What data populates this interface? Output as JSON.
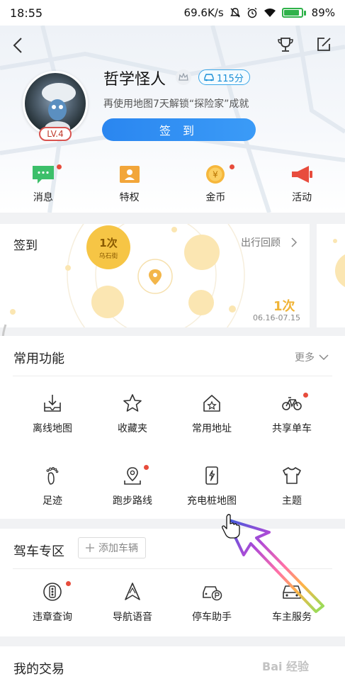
{
  "status_bar": {
    "time": "18:55",
    "network_speed": "69.6K/s",
    "battery": "89%",
    "battery_level": 0.89,
    "battery_color": "#2fb24a"
  },
  "profile": {
    "username": "哲学怪人",
    "level": "LV.4",
    "score": "115分",
    "hint": "再使用地图7天解锁“探险家”成就",
    "signin_label": "签 到"
  },
  "quick_actions": [
    {
      "label": "消息",
      "icon": "message-icon",
      "dot": true
    },
    {
      "label": "特权",
      "icon": "privilege-icon",
      "dot": false
    },
    {
      "label": "金币",
      "icon": "coin-icon",
      "dot": true
    },
    {
      "label": "活动",
      "icon": "megaphone-icon",
      "dot": false
    }
  ],
  "checkin": {
    "title": "签到",
    "trip_review": "出行回顾",
    "count": "1次",
    "place": "乌石街",
    "total": "1次",
    "date_range": "06.16-07.15"
  },
  "common_functions": {
    "title": "常用功能",
    "more": "更多",
    "items": [
      {
        "label": "离线地图",
        "icon": "offline-map-icon",
        "dot": false
      },
      {
        "label": "收藏夹",
        "icon": "star-icon",
        "dot": false
      },
      {
        "label": "常用地址",
        "icon": "home-star-icon",
        "dot": false
      },
      {
        "label": "共享单车",
        "icon": "bicycle-icon",
        "dot": true
      },
      {
        "label": "足迹",
        "icon": "footprint-icon",
        "dot": false
      },
      {
        "label": "跑步路线",
        "icon": "run-route-icon",
        "dot": true
      },
      {
        "label": "充电桩地图",
        "icon": "charging-pile-icon",
        "dot": false
      },
      {
        "label": "主题",
        "icon": "tshirt-icon",
        "dot": false
      }
    ]
  },
  "driving": {
    "title": "驾车专区",
    "add_vehicle": "添加车辆",
    "items": [
      {
        "label": "违章查询",
        "icon": "violation-icon",
        "dot": true
      },
      {
        "label": "导航语音",
        "icon": "navigation-voice-icon",
        "dot": false
      },
      {
        "label": "停车助手",
        "icon": "parking-icon",
        "dot": false
      },
      {
        "label": "车主服务",
        "icon": "car-service-icon",
        "dot": false
      }
    ]
  },
  "transactions": {
    "title": "我的交易"
  },
  "watermark": "Bai 经验",
  "colors": {
    "accent_blue": "#2a86f0",
    "badge_red": "#e74c3c",
    "gold": "#f6c545"
  }
}
